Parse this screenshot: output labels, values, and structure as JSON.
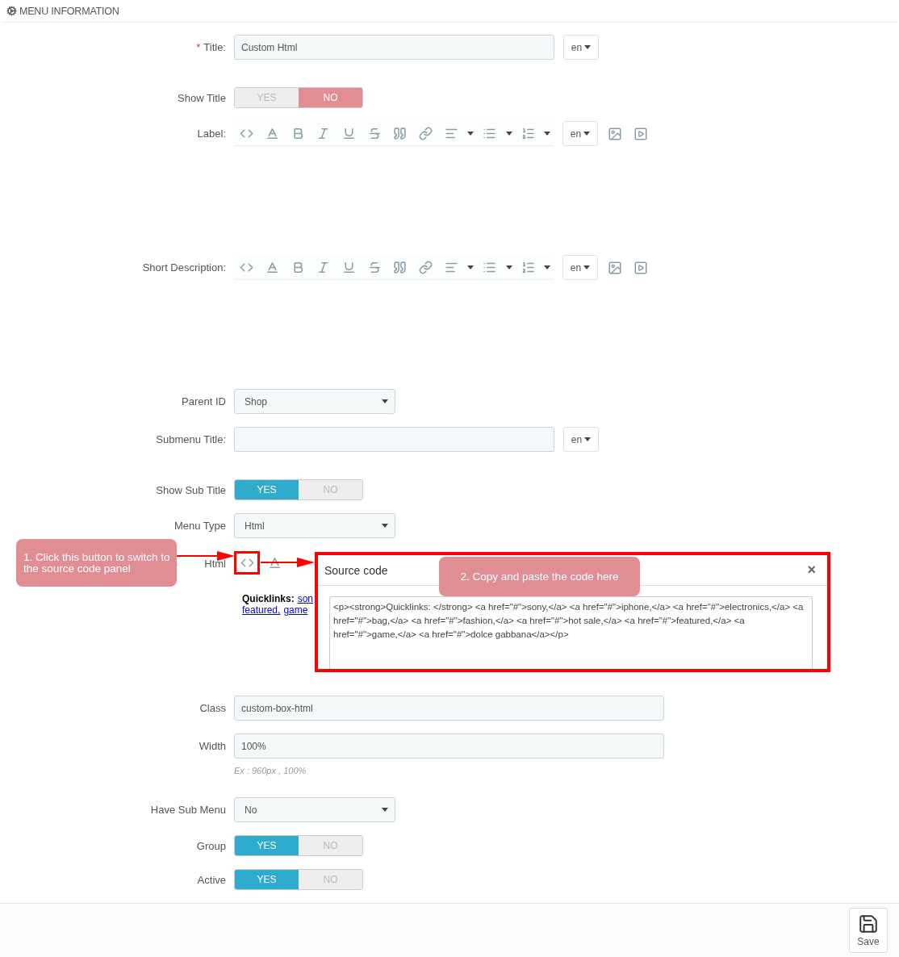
{
  "header": {
    "title": "MENU INFORMATION"
  },
  "fields": [
    {
      "kind": "text",
      "label": "Title:",
      "required_mark": "*",
      "value": "Custom Html",
      "lang": "en"
    },
    {
      "kind": "switch",
      "label": "Show Title",
      "on": false,
      "yes": "YES",
      "no": "NO"
    },
    {
      "kind": "editor",
      "label": "Label:",
      "lang": "en"
    },
    {
      "kind": "editor",
      "label": "Short Description:",
      "lang": "en"
    },
    {
      "kind": "select",
      "label": "Parent ID",
      "value": "Shop"
    },
    {
      "kind": "text",
      "label": "Submenu Title:",
      "lang": "en"
    },
    {
      "kind": "switch",
      "label": "Show Sub Title",
      "on": true,
      "yes": "YES",
      "no": "NO"
    },
    {
      "kind": "select",
      "label": "Menu Type",
      "value": "Html"
    },
    {
      "kind": "html",
      "label": "Html",
      "preview_lines": [
        {
          "bold": "Quicklinks:",
          "links": [
            "son"
          ]
        },
        {
          "links": [
            "featured,",
            "game"
          ]
        }
      ]
    },
    {
      "kind": "text",
      "label": "Class",
      "value": "custom-box-html"
    },
    {
      "kind": "text",
      "label": "Width",
      "value": "100%",
      "hint": "Ex : 960px , 100%"
    },
    {
      "kind": "select",
      "label": "Have Sub Menu",
      "value": "No"
    },
    {
      "kind": "switch",
      "label": "Group",
      "on": true,
      "yes": "YES",
      "no": "NO"
    },
    {
      "kind": "switch",
      "label": "Active",
      "on": true,
      "yes": "YES",
      "no": "NO"
    }
  ],
  "source_panel": {
    "title": "Source code",
    "close": "×",
    "code": "<p><strong>Quicklinks: </strong> <a href=\"#\">sony,</a> <a href=\"#\">iphone,</a> <a href=\"#\">electronics,</a> <a href=\"#\">bag,</a> <a href=\"#\">fashion,</a> <a href=\"#\">hot sale,</a> <a href=\"#\">featured,</a> <a href=\"#\">game,</a> <a href=\"#\">dolce gabbana</a></p>"
  },
  "callouts": [
    {
      "text": "1. Click this button to switch to the source code panel"
    },
    {
      "text": "2. Copy and paste the code here"
    }
  ],
  "footer": {
    "save": "Save"
  }
}
